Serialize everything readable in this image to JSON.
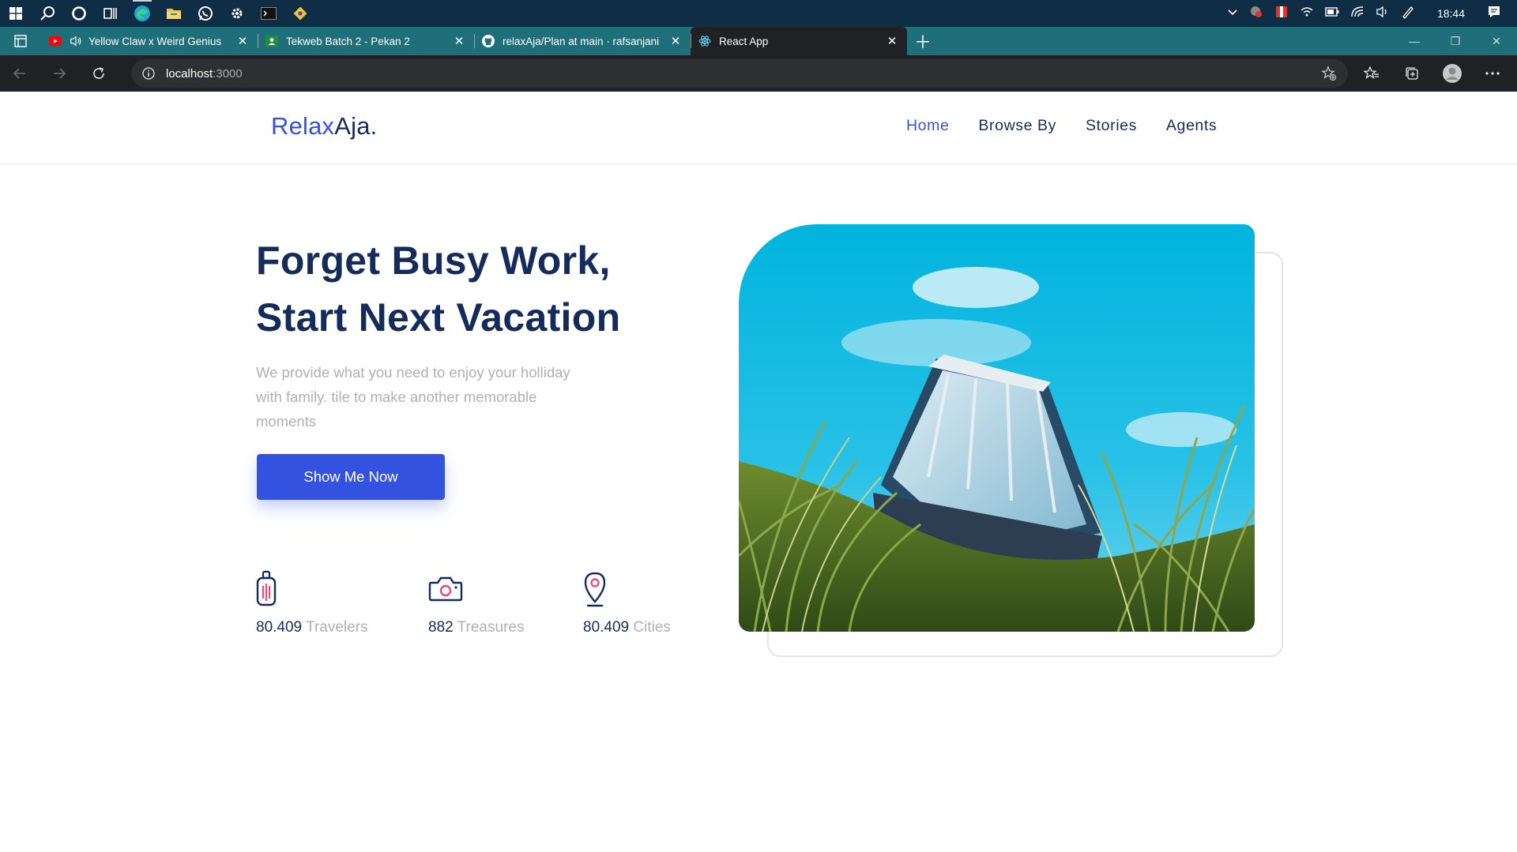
{
  "taskbar": {
    "icons": [
      "windows-start-icon",
      "search-icon",
      "cortana-icon",
      "task-view-icon",
      "edge-icon",
      "file-explorer-icon",
      "whatsapp-icon",
      "settings-icon",
      "terminal-icon",
      "git-icon"
    ],
    "clock": "18:44"
  },
  "browser": {
    "tabs": [
      {
        "title": "Yellow Claw x Weird Genius",
        "icon": "youtube-icon",
        "audio": true
      },
      {
        "title": "Tekweb Batch 2 - Pekan 2",
        "icon": "classroom-icon"
      },
      {
        "title": "relaxAja/Plan at main · rafsanjani",
        "icon": "github-icon"
      },
      {
        "title": "React App",
        "icon": "react-icon",
        "active": true
      }
    ],
    "url_host": "localhost",
    "url_port": ":3000"
  },
  "site": {
    "logo_part1": "Relax",
    "logo_part2": "Aja.",
    "nav": [
      "Home",
      "Browse By",
      "Stories",
      "Agents"
    ],
    "active_nav": "Home",
    "hero_title_line1": "Forget Busy Work,",
    "hero_title_line2": "Start Next Vacation",
    "hero_desc": "We provide what you need to enjoy your holliday with family. tile to make another memorable moments",
    "cta_label": "Show Me Now",
    "stats": [
      {
        "value": "80.409",
        "label": "Travelers",
        "icon": "suitcase-icon"
      },
      {
        "value": "882",
        "label": "Treasures",
        "icon": "camera-icon"
      },
      {
        "value": "80.409",
        "label": "Cities",
        "icon": "map-pin-icon"
      }
    ]
  },
  "colors": {
    "primary": "#3252df",
    "navy": "#152c5b",
    "muted": "#b0b0b0",
    "accent_pink": "#e74c7c"
  }
}
